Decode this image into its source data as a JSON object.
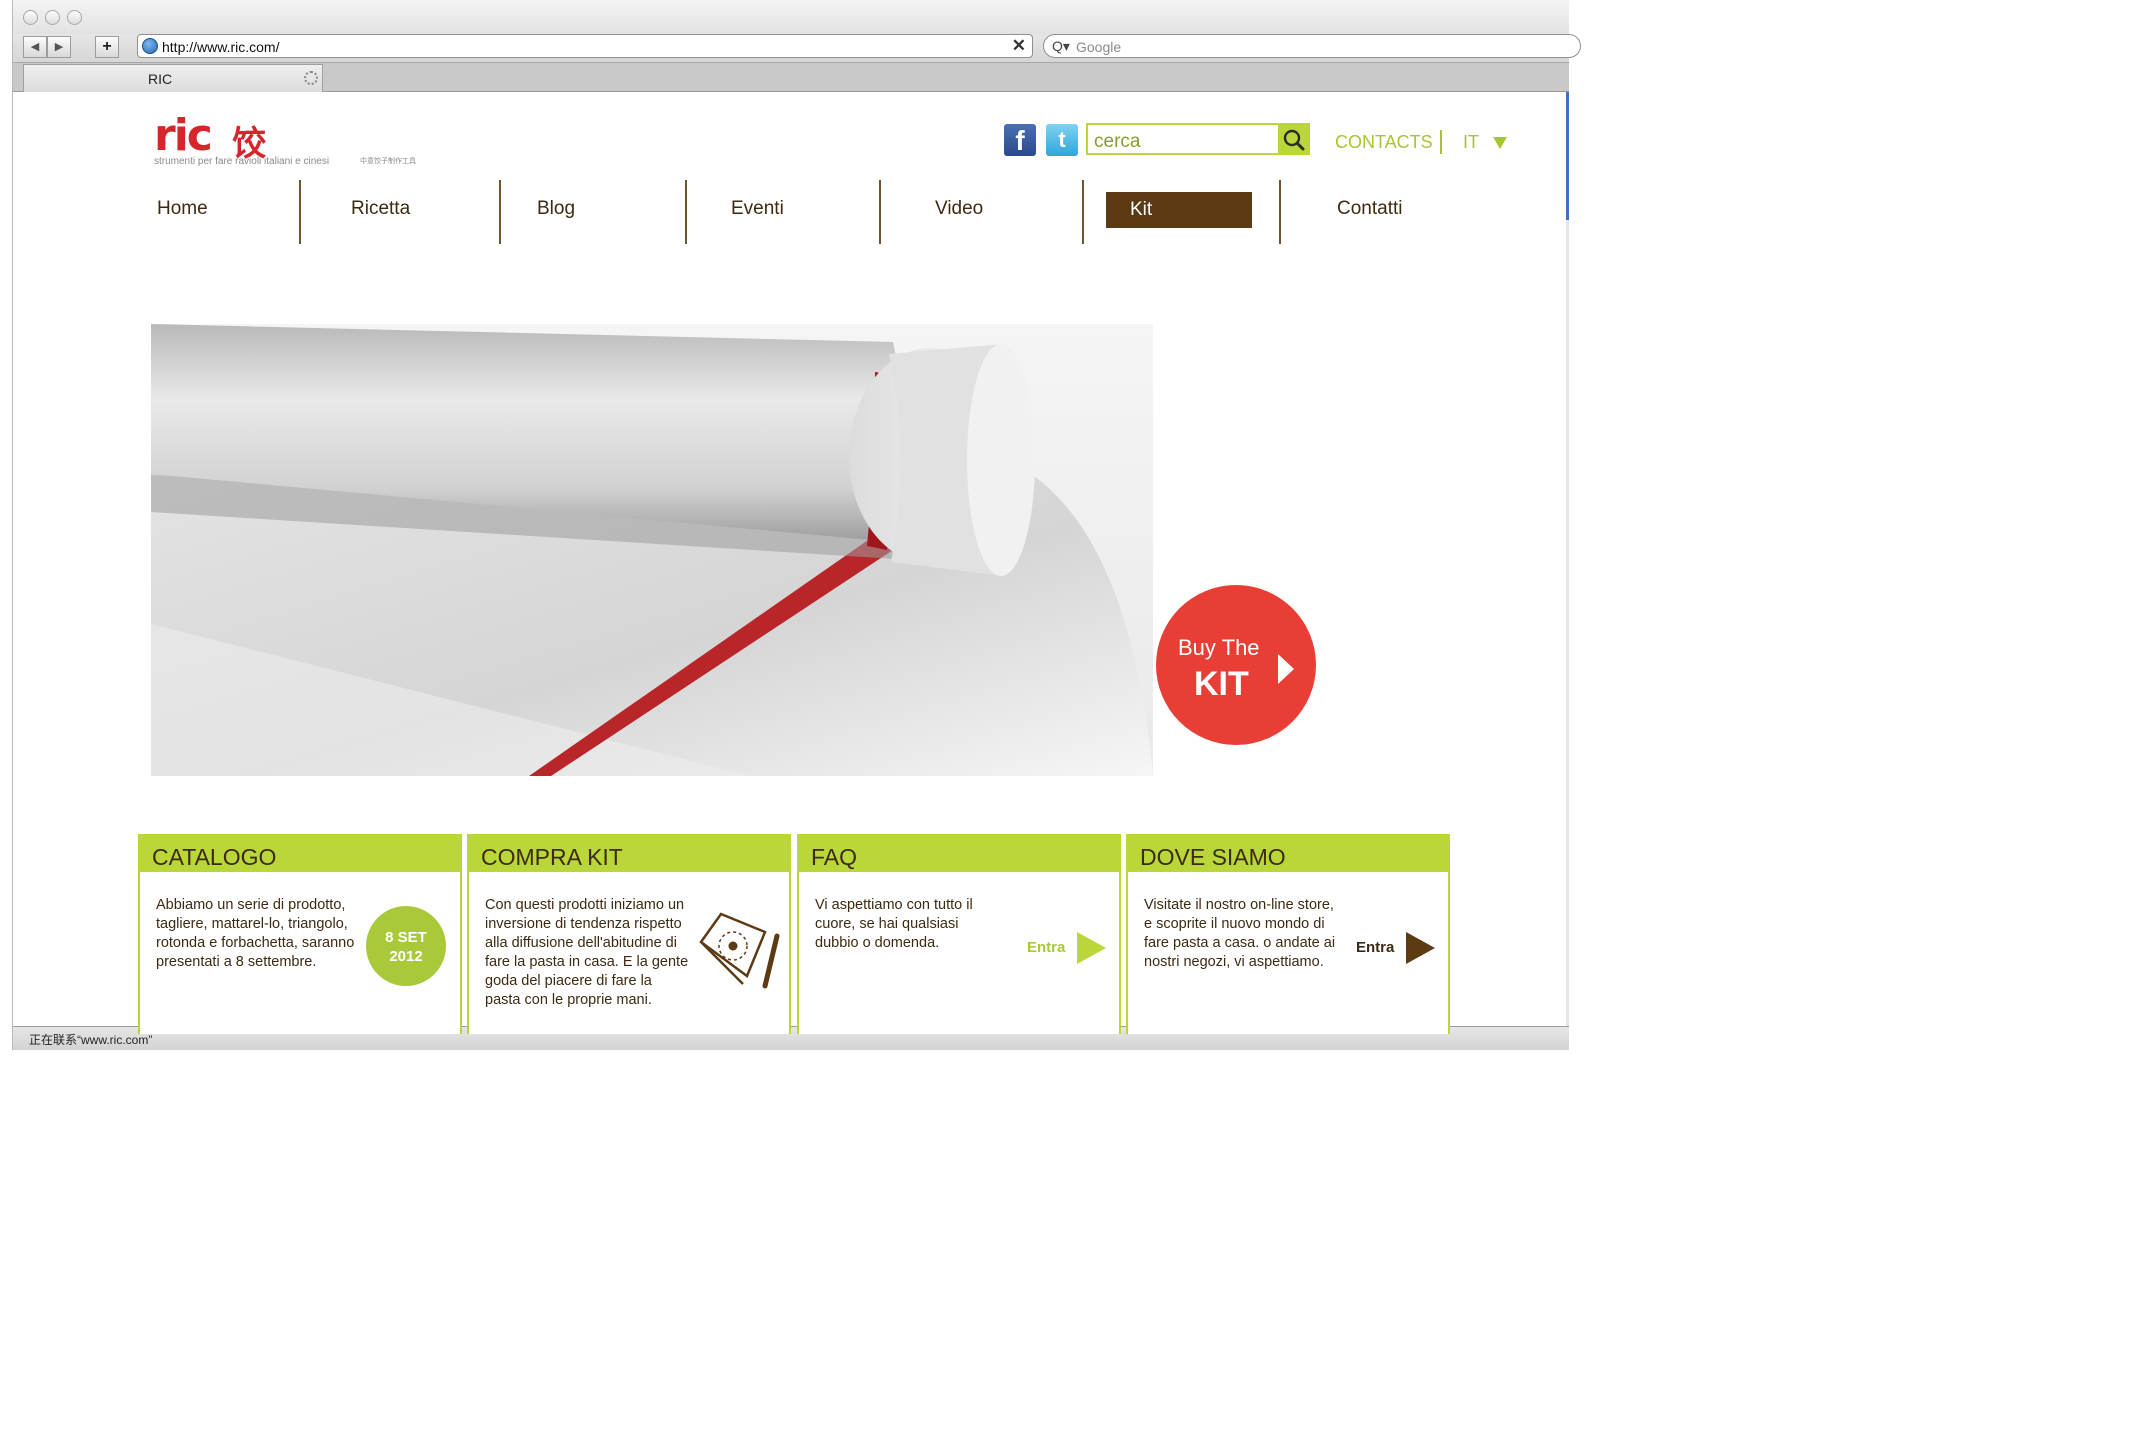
{
  "browser": {
    "url": "http://www.ric.com/",
    "search_placeholder": "Google",
    "tab_title": "RIC",
    "status": "正在联系“www.ric.com”",
    "nav_add": "+",
    "nav_back": "◀",
    "nav_forward": "▶",
    "stop": "✕",
    "search_glyph": "Q▾"
  },
  "header": {
    "logo_word": "ric",
    "logo_cjk": "饺",
    "logo_tagline": "strumenti per fare ravioli italiani e cinesi",
    "logo_tagline_cjk": "中意饺子制作工具",
    "search_placeholder": "cerca",
    "contacts_label": "CONTACTS",
    "lang_label": "IT",
    "facebook_label": "f",
    "twitter_label": "t"
  },
  "nav": {
    "items": [
      {
        "label": "Home"
      },
      {
        "label": "Ricetta"
      },
      {
        "label": "Blog"
      },
      {
        "label": "Eventi"
      },
      {
        "label": "Video"
      },
      {
        "label": "Kit"
      },
      {
        "label": "Contatti"
      }
    ],
    "active": "Kit"
  },
  "hero": {
    "buy_line1": "Buy The",
    "buy_line2": "KIT"
  },
  "boxes": [
    {
      "title": "CATALOGO",
      "text": "Abbiamo un serie di prodotto, tagliere, mattarel-lo, triangolo, rotonda e forbachetta, saranno presentati a 8 settembre.",
      "date_line1": "8 SET",
      "date_line2": "2012"
    },
    {
      "title": "COMPRA KIT",
      "text": "Con questi prodotti iniziamo un inversione di tendenza rispetto alla diffusione dell'abitudine di fare la pasta in casa. E la gente goda del piacere di fare la pasta con le proprie mani."
    },
    {
      "title": "FAQ",
      "text": "Vi aspettiamo con tutto il cuore, se hai qualsiasi dubbio o domenda.",
      "link": "Entra"
    },
    {
      "title": "DOVE SIAMO",
      "text": "Visitate il nostro on-line store, e scoprite il nuovo mondo di fare pasta a casa. o andate ai nostri negozi, vi aspettiamo.",
      "link": "Entra"
    }
  ],
  "colors": {
    "accent_green": "#b9d739",
    "brand_red": "#d7262b",
    "nav_brown": "#5c3a14",
    "buy_red": "#e83e35"
  }
}
